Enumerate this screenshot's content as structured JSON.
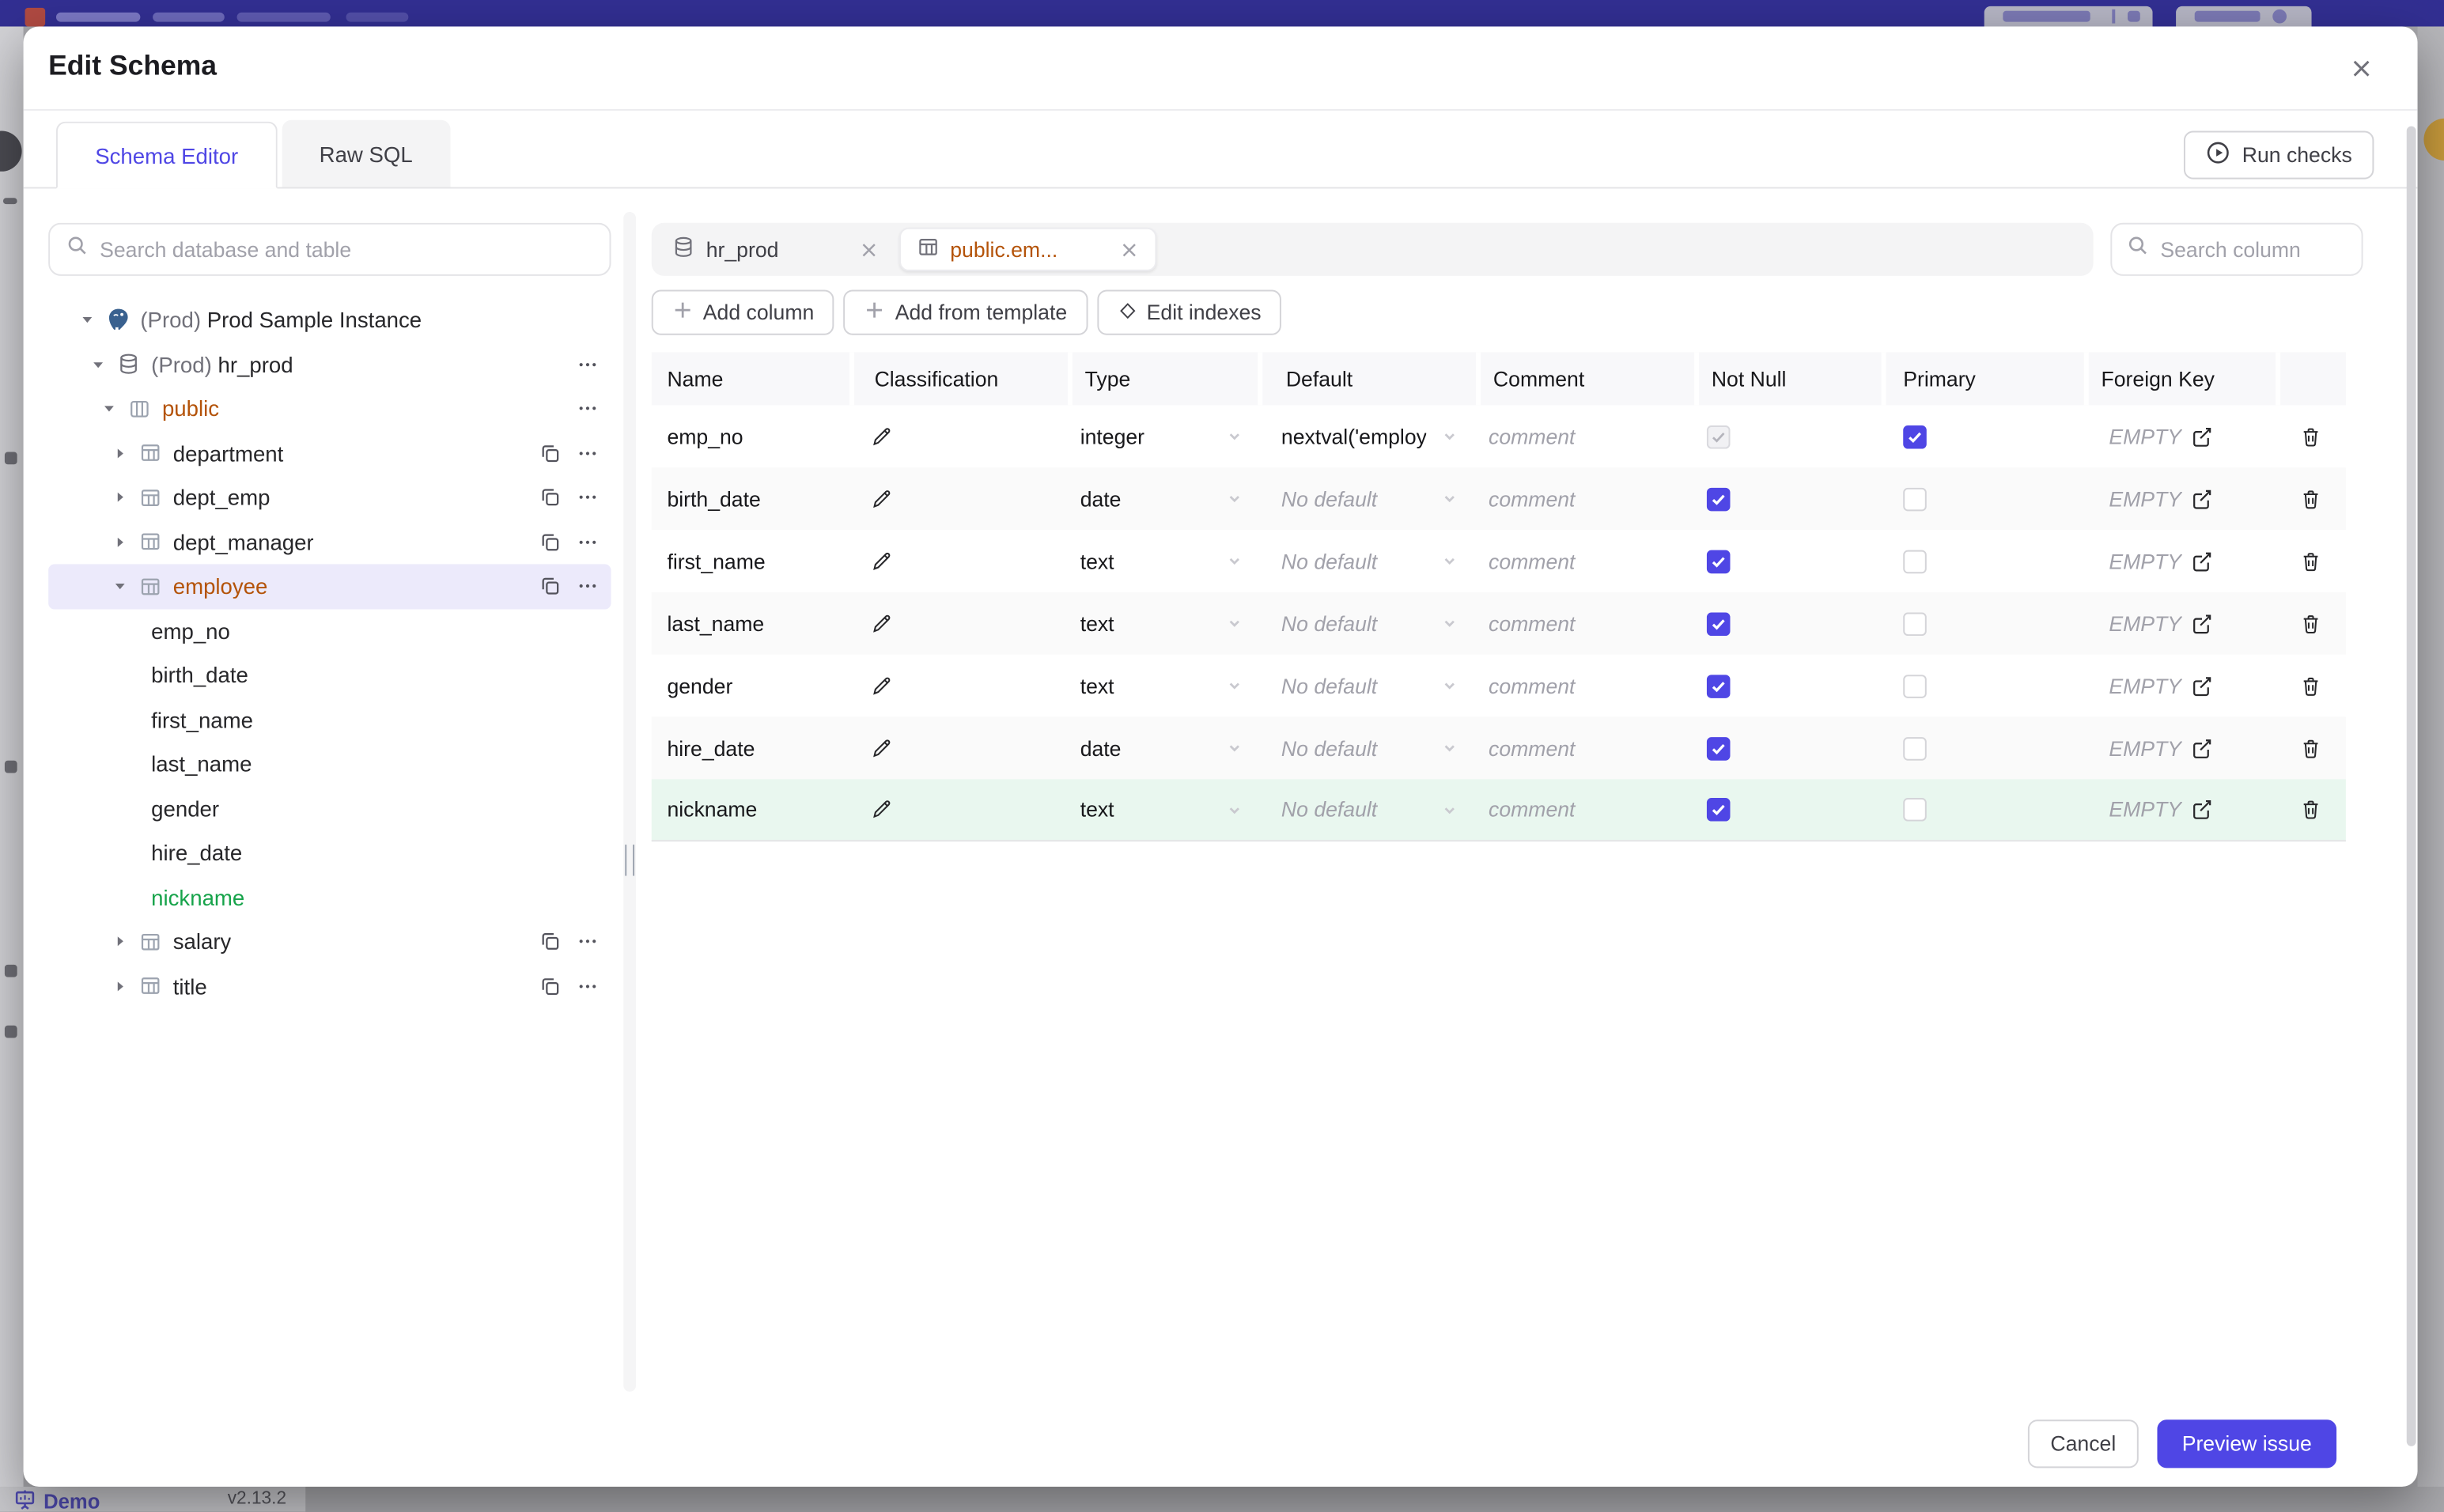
{
  "colors": {
    "accent": "#4f46e5",
    "opened_item": "#b45309",
    "added_item": "#16a34a",
    "added_row_bg": "#e9f7ef",
    "selected_row_bg": "#eceafb",
    "topbar": "#322f92"
  },
  "background": {
    "footer": {
      "demo_label": "Demo",
      "version": "v2.13.2"
    }
  },
  "modal": {
    "title": "Edit Schema",
    "close_icon": "close-icon",
    "tabs": [
      {
        "label": "Schema Editor",
        "active": true
      },
      {
        "label": "Raw SQL",
        "active": false
      }
    ],
    "run_checks_label": "Run checks",
    "sidebar": {
      "search_placeholder": "Search database and table",
      "tree": [
        {
          "id": "instance",
          "level": 0,
          "caret": "down",
          "icon": "postgres",
          "prefix": "(Prod)",
          "label": "Prod Sample Instance",
          "actions": []
        },
        {
          "id": "database",
          "level": 1,
          "caret": "down",
          "icon": "database",
          "prefix": "(Prod)",
          "label": "hr_prod",
          "actions": [
            "dots"
          ]
        },
        {
          "id": "schema-public",
          "level": 2,
          "caret": "down",
          "icon": "schema",
          "label": "public",
          "color": "orange",
          "actions": [
            "dots"
          ]
        },
        {
          "id": "department",
          "level": 3,
          "caret": "right",
          "icon": "table",
          "label": "department",
          "actions": [
            "copy",
            "dots"
          ]
        },
        {
          "id": "dept_emp",
          "level": 3,
          "caret": "right",
          "icon": "table",
          "label": "dept_emp",
          "actions": [
            "copy",
            "dots"
          ]
        },
        {
          "id": "dept_manager",
          "level": 3,
          "caret": "right",
          "icon": "table",
          "label": "dept_manager",
          "actions": [
            "copy",
            "dots"
          ]
        },
        {
          "id": "employee",
          "level": 3,
          "caret": "down",
          "icon": "table",
          "label": "employee",
          "color": "orange",
          "selected": true,
          "actions": [
            "copy",
            "dots"
          ]
        },
        {
          "id": "emp_no",
          "level": 4,
          "label": "emp_no"
        },
        {
          "id": "birth_date",
          "level": 4,
          "label": "birth_date"
        },
        {
          "id": "first_name",
          "level": 4,
          "label": "first_name"
        },
        {
          "id": "last_name",
          "level": 4,
          "label": "last_name"
        },
        {
          "id": "gender",
          "level": 4,
          "label": "gender"
        },
        {
          "id": "hire_date",
          "level": 4,
          "label": "hire_date"
        },
        {
          "id": "nickname",
          "level": 4,
          "label": "nickname",
          "color": "green"
        },
        {
          "id": "salary",
          "level": 3,
          "caret": "right",
          "icon": "table",
          "label": "salary",
          "actions": [
            "copy",
            "dots"
          ]
        },
        {
          "id": "title",
          "level": 3,
          "caret": "right",
          "icon": "table",
          "label": "title",
          "actions": [
            "copy",
            "dots"
          ]
        }
      ]
    },
    "editor": {
      "open_tabs": [
        {
          "icon": "database",
          "label": "hr_prod",
          "active": false
        },
        {
          "icon": "table",
          "label": "public.em...",
          "active": true
        }
      ],
      "column_search_placeholder": "Search column",
      "toolbar": [
        {
          "icon": "plus",
          "label": "Add column"
        },
        {
          "icon": "plus",
          "label": "Add from template"
        },
        {
          "icon": "diamond",
          "label": "Edit indexes"
        }
      ],
      "table": {
        "headers": [
          "Name",
          "Classification",
          "Type",
          "Default",
          "Comment",
          "Not Null",
          "Primary",
          "Foreign Key",
          ""
        ],
        "comment_placeholder": "comment",
        "foreign_key_empty": "EMPTY",
        "rows": [
          {
            "name": "emp_no",
            "type": "integer",
            "default_text": "nextval('employ",
            "default_muted": false,
            "not_null": "checked_disabled",
            "primary": "checked",
            "state": "normal"
          },
          {
            "name": "birth_date",
            "type": "date",
            "default_text": "No default",
            "default_muted": true,
            "not_null": "checked",
            "primary": "unchecked",
            "state": "normal"
          },
          {
            "name": "first_name",
            "type": "text",
            "default_text": "No default",
            "default_muted": true,
            "not_null": "checked",
            "primary": "unchecked",
            "state": "normal"
          },
          {
            "name": "last_name",
            "type": "text",
            "default_text": "No default",
            "default_muted": true,
            "not_null": "checked",
            "primary": "unchecked",
            "state": "normal"
          },
          {
            "name": "gender",
            "type": "text",
            "default_text": "No default",
            "default_muted": true,
            "not_null": "checked",
            "primary": "unchecked",
            "state": "normal"
          },
          {
            "name": "hire_date",
            "type": "date",
            "default_text": "No default",
            "default_muted": true,
            "not_null": "checked",
            "primary": "unchecked",
            "state": "normal"
          },
          {
            "name": "nickname",
            "type": "text",
            "default_text": "No default",
            "default_muted": true,
            "not_null": "checked",
            "primary": "unchecked",
            "state": "added"
          }
        ]
      }
    },
    "footer": {
      "cancel_label": "Cancel",
      "preview_label": "Preview issue"
    }
  }
}
